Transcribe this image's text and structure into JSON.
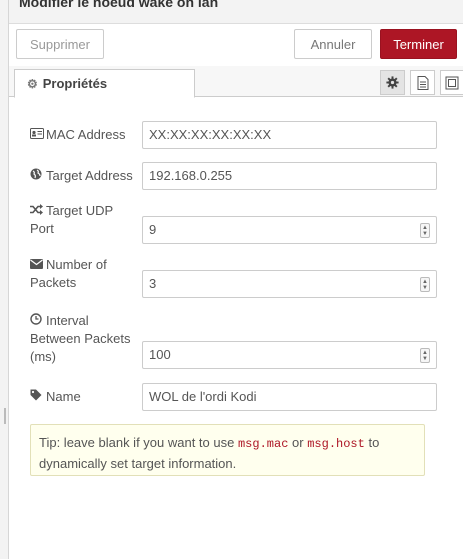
{
  "tray": {
    "title": "Modifier le noeud wake on lan"
  },
  "toolbar": {
    "delete_label": "Supprimer",
    "cancel_label": "Annuler",
    "done_label": "Terminer"
  },
  "tabs": [
    {
      "label": "Propriétés",
      "icon": "gear-icon"
    }
  ],
  "tab_icons": [
    "gear-icon",
    "document-icon",
    "frame-icon"
  ],
  "fields": {
    "mac": {
      "label": "MAC Address",
      "icon": "id-card-icon",
      "value": "XX:XX:XX:XX:XX:XX"
    },
    "target": {
      "label": "Target Address",
      "icon": "globe-icon",
      "value": "192.168.0.255"
    },
    "udp_port": {
      "label": "Target UDP Port",
      "icon": "random-icon",
      "value": "9"
    },
    "packets": {
      "label": "Number of Packets",
      "icon": "envelope-icon",
      "value": "3"
    },
    "interval": {
      "label": "Interval Between Packets (ms)",
      "icon": "clock-icon",
      "value": "100"
    },
    "name": {
      "label": "Name",
      "icon": "tag-icon",
      "value": "WOL de l'ordi Kodi"
    }
  },
  "tip": {
    "prefix": "Tip: leave blank if you want to use",
    "code1": "msg.mac",
    "mid": "or",
    "code2": "msg.host",
    "suffix": "to dynamically set target information."
  }
}
